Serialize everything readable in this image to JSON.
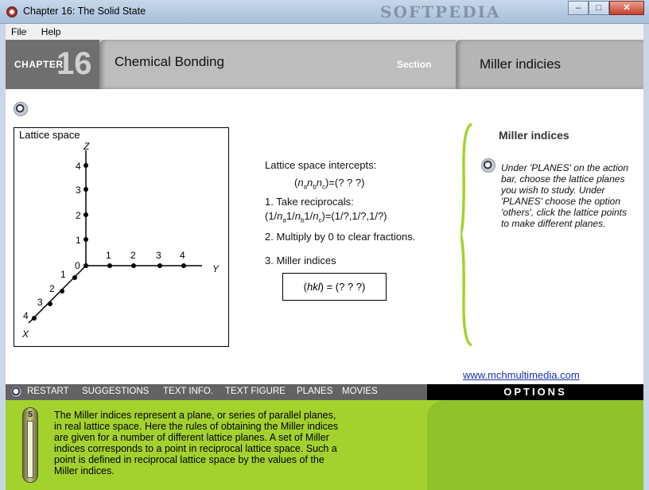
{
  "window": {
    "title": "Chapter 16: The Solid State",
    "watermark": "SOFTPEDIA",
    "buttons": {
      "minimize": "–",
      "maximize": "□",
      "close": "✕"
    }
  },
  "menu": {
    "file": "File",
    "help": "Help"
  },
  "header": {
    "chapter_label": "CHAPTER",
    "chapter_number": "16",
    "topic": "Chemical Bonding",
    "section_label": "Section",
    "section_title": "Miller indicies"
  },
  "lattice": {
    "label": "Lattice space",
    "axis_z": "Z",
    "axis_y": "Y",
    "axis_x": "X",
    "origin": "0",
    "ticks": [
      "1",
      "2",
      "3",
      "4"
    ]
  },
  "procedure": {
    "intercepts_label": "Lattice space intercepts:",
    "intercepts_value": "=(? ? ?)",
    "step1": "1. Take reciprocals:",
    "step1_value": "=(1/?,1/?,1/?)",
    "step2": "2. Multiply by 0 to clear fractions.",
    "step3": "3. Miller indices",
    "hkl_value": ") = (? ? ?)"
  },
  "info": {
    "title": "Miller indices",
    "text": "Under 'PLANES' on the action bar, choose the lattice planes you wish to study.  Under 'PLANES' choose the option 'others', click the lattice points to make different planes."
  },
  "url": "www.mchmultimedia.com",
  "actionbar": {
    "items": [
      "RESTART",
      "SUGGESTIONS",
      "TEXT INFO.",
      "TEXT FIGURE",
      "PLANES",
      "MOVIES"
    ],
    "options": "OPTIONS"
  },
  "bottom": {
    "page": "5",
    "text": "The Miller indices represent a plane, or series of parallel planes, in real lattice space. Here the rules of obtaining the Miller indices are given for a number of different lattice planes.  A set of Miller indices corresponds to a point in reciprocal lattice space.  Such a point is defined in reciprocal lattice space by the values of the Miller indices."
  },
  "colors": {
    "accent_green": "#a3d22e",
    "header_gray": "#6f6f6f",
    "link_blue": "#1a33aa"
  }
}
